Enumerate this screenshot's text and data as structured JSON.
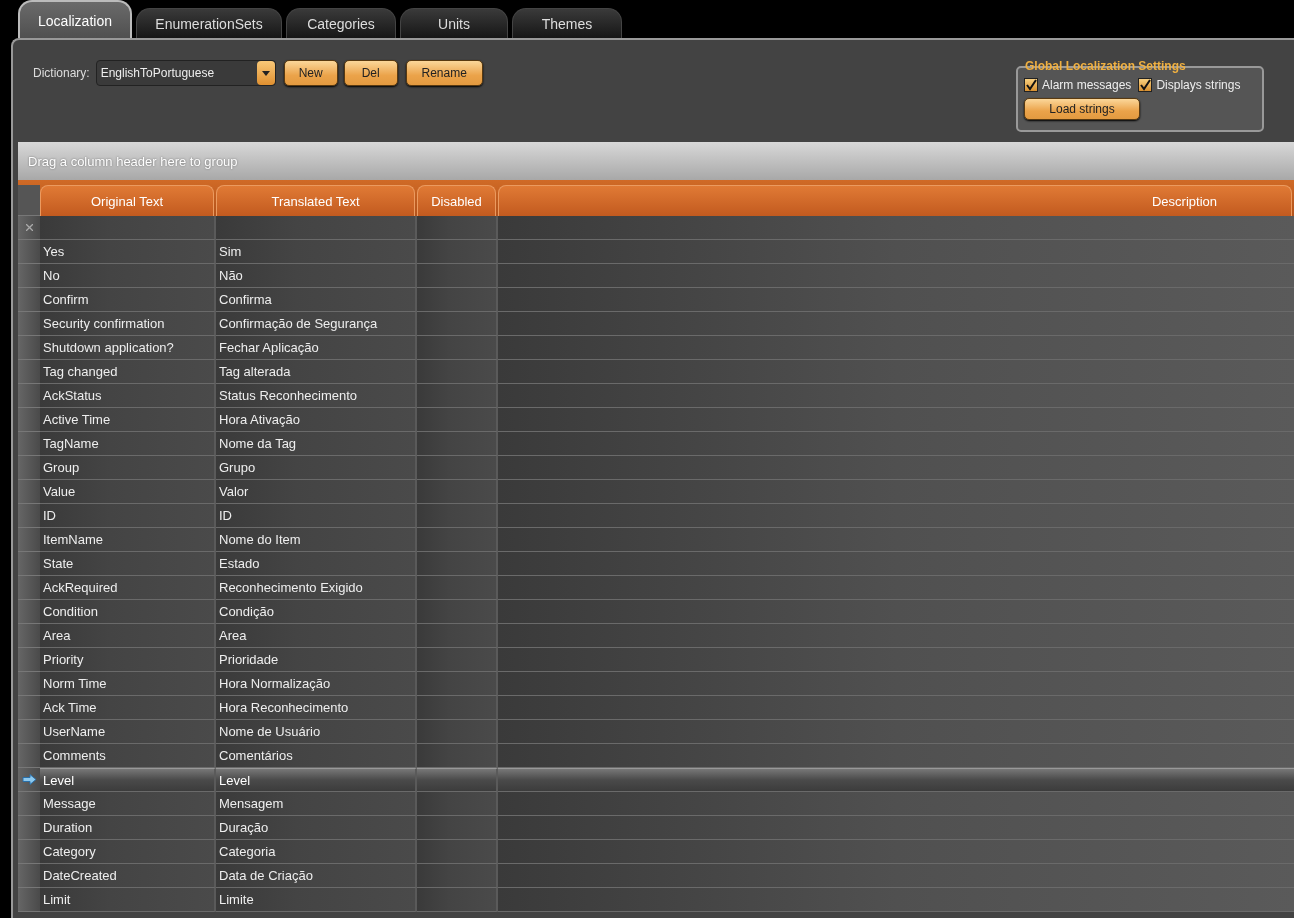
{
  "tabs": [
    {
      "label": "Localization",
      "selected": true
    },
    {
      "label": "EnumerationSets",
      "selected": false
    },
    {
      "label": "Categories",
      "selected": false
    },
    {
      "label": "Units",
      "selected": false
    },
    {
      "label": "Themes",
      "selected": false
    }
  ],
  "toolbar": {
    "dictionary_label": "Dictionary:",
    "dictionary_value": "EnglishToPortuguese",
    "buttons": [
      "New",
      "Del",
      "Rename"
    ]
  },
  "global_settings": {
    "title": "Global Localization Settings",
    "checkboxes": [
      {
        "label": "Alarm messages",
        "checked": true
      },
      {
        "label": "Displays strings",
        "checked": true
      }
    ],
    "button": "Load strings"
  },
  "grid": {
    "group_hint": "Drag a column header here to group",
    "columns": [
      "Original Text",
      "Translated Text",
      "Disabled",
      "Description"
    ],
    "rows": [
      {
        "original": "Yes",
        "translated": "Sim",
        "selected": false
      },
      {
        "original": "No",
        "translated": "Não",
        "selected": false
      },
      {
        "original": "Confirm",
        "translated": "Confirma",
        "selected": false
      },
      {
        "original": "Security confirmation",
        "translated": "Confirmação de Segurança",
        "selected": false
      },
      {
        "original": "Shutdown application?",
        "translated": "Fechar Aplicação",
        "selected": false
      },
      {
        "original": "Tag changed",
        "translated": "Tag alterada",
        "selected": false
      },
      {
        "original": "AckStatus",
        "translated": "Status Reconhecimento",
        "selected": false
      },
      {
        "original": "Active Time",
        "translated": "Hora Ativação",
        "selected": false
      },
      {
        "original": "TagName",
        "translated": "Nome da Tag",
        "selected": false
      },
      {
        "original": "Group",
        "translated": "Grupo",
        "selected": false
      },
      {
        "original": "Value",
        "translated": "Valor",
        "selected": false
      },
      {
        "original": "ID",
        "translated": "ID",
        "selected": false
      },
      {
        "original": "ItemName",
        "translated": "Nome do Item",
        "selected": false
      },
      {
        "original": "State",
        "translated": "Estado",
        "selected": false
      },
      {
        "original": "AckRequired",
        "translated": "Reconhecimento Exigido",
        "selected": false
      },
      {
        "original": "Condition",
        "translated": "Condição",
        "selected": false
      },
      {
        "original": "Area",
        "translated": "Area",
        "selected": false
      },
      {
        "original": "Priority",
        "translated": "Prioridade",
        "selected": false
      },
      {
        "original": "Norm Time",
        "translated": "Hora Normalização",
        "selected": false
      },
      {
        "original": "Ack Time",
        "translated": "Hora Reconhecimento",
        "selected": false
      },
      {
        "original": "UserName",
        "translated": "Nome de Usuário",
        "selected": false
      },
      {
        "original": "Comments",
        "translated": "Comentários",
        "selected": false
      },
      {
        "original": "Level",
        "translated": "Level",
        "selected": true
      },
      {
        "original": "Message",
        "translated": "Mensagem",
        "selected": false
      },
      {
        "original": "Duration",
        "translated": "Duração",
        "selected": false
      },
      {
        "original": "Category",
        "translated": "Categoria",
        "selected": false
      },
      {
        "original": "DateCreated",
        "translated": "Data de Criação",
        "selected": false
      },
      {
        "original": "Limit",
        "translated": "Limite",
        "selected": false
      }
    ]
  }
}
